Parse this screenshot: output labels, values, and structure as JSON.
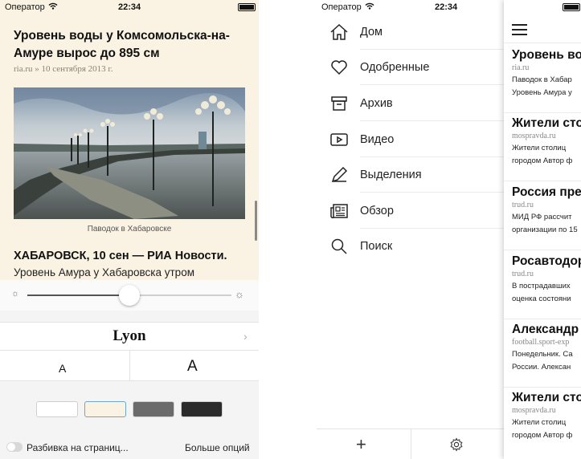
{
  "left_phone": {
    "status": {
      "carrier": "Оператор",
      "time": "22:34"
    },
    "article": {
      "title": "Уровень воды у Комсомольска-на-Амуре вырос до 895 см",
      "meta": "ria.ru » 10 сентября 2013 г.",
      "photo_caption": "Паводок в Хабаровске",
      "lead": "ХАБАРОВСК, 10 сен — РИА Новости.",
      "body_line": "Уровень Амура у Хабаровска утром"
    },
    "settings": {
      "brightness": 0.5,
      "font_name": "Lyon",
      "size_small": "A",
      "size_large": "A",
      "themes": [
        {
          "name": "white",
          "color": "#ffffff"
        },
        {
          "name": "sepia",
          "color": "#faf3e3"
        },
        {
          "name": "gray",
          "color": "#6b6b6b"
        },
        {
          "name": "dark",
          "color": "#2b2b2b"
        }
      ],
      "selected_theme": "sepia",
      "pagination_label": "Разбивка на страниц...",
      "more_options": "Больше опций"
    }
  },
  "right_phone": {
    "status": {
      "carrier": "Оператор",
      "time": "22:34"
    },
    "menu": [
      {
        "label": "Дом",
        "icon": "home-icon"
      },
      {
        "label": "Одобренные",
        "icon": "heart-icon"
      },
      {
        "label": "Архив",
        "icon": "archive-icon"
      },
      {
        "label": "Видео",
        "icon": "video-icon"
      },
      {
        "label": "Выделения",
        "icon": "pen-icon"
      },
      {
        "label": "Обзор",
        "icon": "newspaper-icon"
      },
      {
        "label": "Поиск",
        "icon": "search-icon"
      }
    ],
    "feed": [
      {
        "title": "Уровень во",
        "source": "ria.ru",
        "lines": [
          "Паводок в Хабар",
          "Уровень Амура у"
        ]
      },
      {
        "title": "Жители сто",
        "source": "mospravda.ru",
        "lines": [
          "Жители столиц",
          "городом Автор ф"
        ]
      },
      {
        "title": "Россия пре",
        "source": "trud.ru",
        "lines": [
          "МИД РФ рассчит",
          "организации по 15"
        ]
      },
      {
        "title": "Росавтодор",
        "source": "trud.ru",
        "lines": [
          "В пострадавших",
          "оценка состояни"
        ]
      },
      {
        "title": "Александр",
        "source": "football.sport-exp",
        "lines": [
          "Понедельник. Са",
          "России. Алексан"
        ]
      },
      {
        "title": "Жители сто",
        "source": "mospravda.ru",
        "lines": [
          "Жители столиц",
          "городом Автор ф"
        ]
      }
    ]
  },
  "colors": {
    "sepia_bg": "#faf3e3",
    "text": "#111111"
  }
}
